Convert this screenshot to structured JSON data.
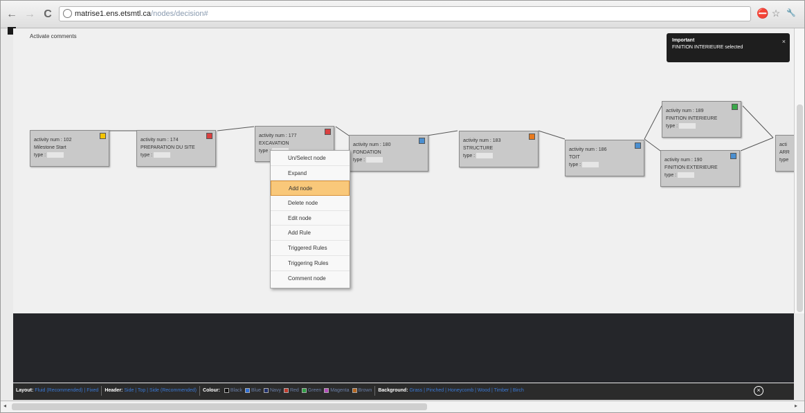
{
  "browser": {
    "url_host": "matrise1.ens.etsmtl.ca",
    "url_path": "/nodes/decision#",
    "back_icon": "←",
    "forward_icon": "→",
    "reload_icon": "C",
    "stop_icon": "⛔",
    "star_icon": "☆",
    "wrench_icon": "🔧"
  },
  "canvas": {
    "activate_comments": "Activate comments"
  },
  "nodes": [
    {
      "line1": "activity num : 102",
      "line2": "Milestone Start",
      "type_label": "type :",
      "badge_color": "#f5c400"
    },
    {
      "line1": "activity num : 174",
      "line2": "PREPARATION DU SITE",
      "type_label": "type :",
      "badge_color": "#d94040"
    },
    {
      "line1": "activity num : 177",
      "line2": "EXCAVATION",
      "type_label": "type :",
      "badge_color": "#d94040"
    },
    {
      "line1": "activity num : 180",
      "line2": "FONDATION",
      "type_label": "type :",
      "badge_color": "#4b8fd0"
    },
    {
      "line1": "activity num : 183",
      "line2": "STRUCTURE",
      "type_label": "type :",
      "badge_color": "#e87a1e"
    },
    {
      "line1": "activity num : 186",
      "line2": "TOIT",
      "type_label": "type :",
      "badge_color": "#4b8fd0"
    },
    {
      "line1": "activity num : 189",
      "line2": "FINITION INTERIEURE",
      "type_label": "type :",
      "badge_color": "#3aa84a"
    },
    {
      "line1": "activity num : 190",
      "line2": "FINITION EXTERIEURE",
      "type_label": "type :",
      "badge_color": "#4b8fd0"
    },
    {
      "line1": "acti",
      "line2": "ARR",
      "type_label": "type",
      "badge_color": "#c9c9c9"
    }
  ],
  "context_menu": {
    "items": [
      "Un/Select node",
      "Expand",
      "Add node",
      "Delete node",
      "Edit node",
      "Add Rule",
      "Triggered Rules",
      "Triggering Rules",
      "Comment node"
    ],
    "highlighted": "Add node"
  },
  "toast": {
    "title": "Important",
    "message": "FINITION INTERIEURE selected",
    "close": "×"
  },
  "toolbar": {
    "layout_label": "Layout:",
    "layout_options": "Fluid (Recommended) | Fixed",
    "header_label": "Header:",
    "header_options": "Side | Top | Side (Recommended)",
    "colour_label": "Colour:",
    "colours": [
      {
        "name": "Black",
        "hex": "#111111"
      },
      {
        "name": "Blue",
        "hex": "#2f6fd6"
      },
      {
        "name": "Navy",
        "hex": "#1f2f6b"
      },
      {
        "name": "Red",
        "hex": "#c0392b"
      },
      {
        "name": "Green",
        "hex": "#2e9e43"
      },
      {
        "name": "Magenta",
        "hex": "#b24bb8"
      },
      {
        "name": "Brown",
        "hex": "#b5651d"
      }
    ],
    "background_label": "Background:",
    "background_options": "Grass | Pinched | Honeycomb | Wood | Timber | Birch",
    "close_icon": "×"
  }
}
